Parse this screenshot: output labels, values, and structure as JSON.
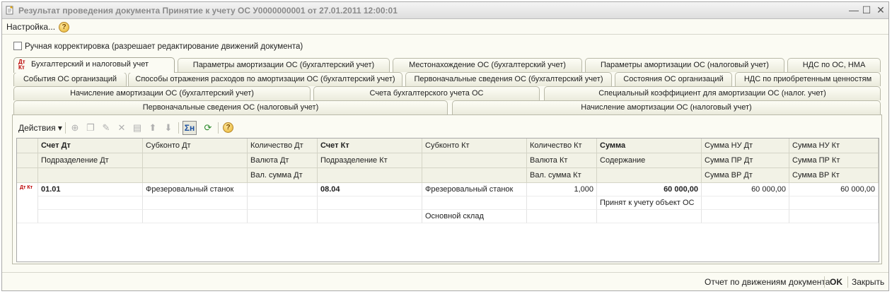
{
  "window": {
    "title": "Результат проведения документа Принятие к учету ОС У0000000001 от 27.01.2011 12:00:01",
    "minimize": "—",
    "maximize": "☐",
    "close": "✕"
  },
  "menu": {
    "settings_label": "Настройка...",
    "help_label": "?"
  },
  "manual_correction": {
    "label": "Ручная корректировка (разрешает редактирование движений документа)",
    "checked": false
  },
  "tabs": {
    "row1": [
      "Бухгалтерский и налоговый учет",
      "Параметры амортизации ОС (бухгалтерский учет)",
      "Местонахождение ОС (бухгалтерский учет)",
      "Параметры амортизации ОС (налоговый учет)",
      "НДС по ОС, НМА"
    ],
    "row2": [
      "События ОС организаций",
      "Способы отражения расходов по амортизации ОС (бухгалтерский учет)",
      "Первоначальные сведения ОС (бухгалтерский учет)",
      "Состояния ОС организаций",
      "НДС по приобретенным ценностям"
    ],
    "row3": [
      "Начисление амортизации ОС (бухгалтерский учет)",
      "Счета бухгалтерского учета ОС",
      "Специальный коэффициент для амортизации ОС (налог. учет)"
    ],
    "row4": [
      "Первоначальные сведения ОС (налоговый учет)",
      "Начисление амортизации ОС (налоговый учет)"
    ],
    "active_icon": "Дт Кт"
  },
  "toolbar": {
    "actions_label": "Действия",
    "help_label": "?"
  },
  "table": {
    "headers": {
      "r1": [
        "Счет Дт",
        "Субконто Дт",
        "Количество Дт",
        "Счет Кт",
        "Субконто Кт",
        "Количество Кт",
        "Сумма",
        "Сумма НУ Дт",
        "Сумма НУ Кт"
      ],
      "r2": [
        "Подразделение Дт",
        "",
        "Валюта Дт",
        "Подразделение Кт",
        "",
        "Валюта Кт",
        "Содержание",
        "Сумма ПР Дт",
        "Сумма ПР Кт"
      ],
      "r3": [
        "",
        "",
        "Вал. сумма Дт",
        "",
        "",
        "Вал. сумма Кт",
        "",
        "Сумма ВР Дт",
        "Сумма ВР Кт"
      ]
    },
    "row": {
      "icon": "Дт Кт",
      "r1": [
        "01.01",
        "Фрезеровальный станок",
        "",
        "08.04",
        "Фрезеровальный станок",
        "1,000",
        "60 000,00",
        "60 000,00",
        "60 000,00"
      ],
      "r2": [
        "",
        "",
        "",
        "",
        "",
        "",
        "Принят к учету объект ОС",
        "",
        ""
      ],
      "r3": [
        "",
        "",
        "",
        "",
        "Основной склад",
        "",
        "",
        "",
        ""
      ]
    }
  },
  "footer": {
    "report_label": "Отчет по движениям документа",
    "ok_label": "OK",
    "close_label": "Закрыть"
  }
}
